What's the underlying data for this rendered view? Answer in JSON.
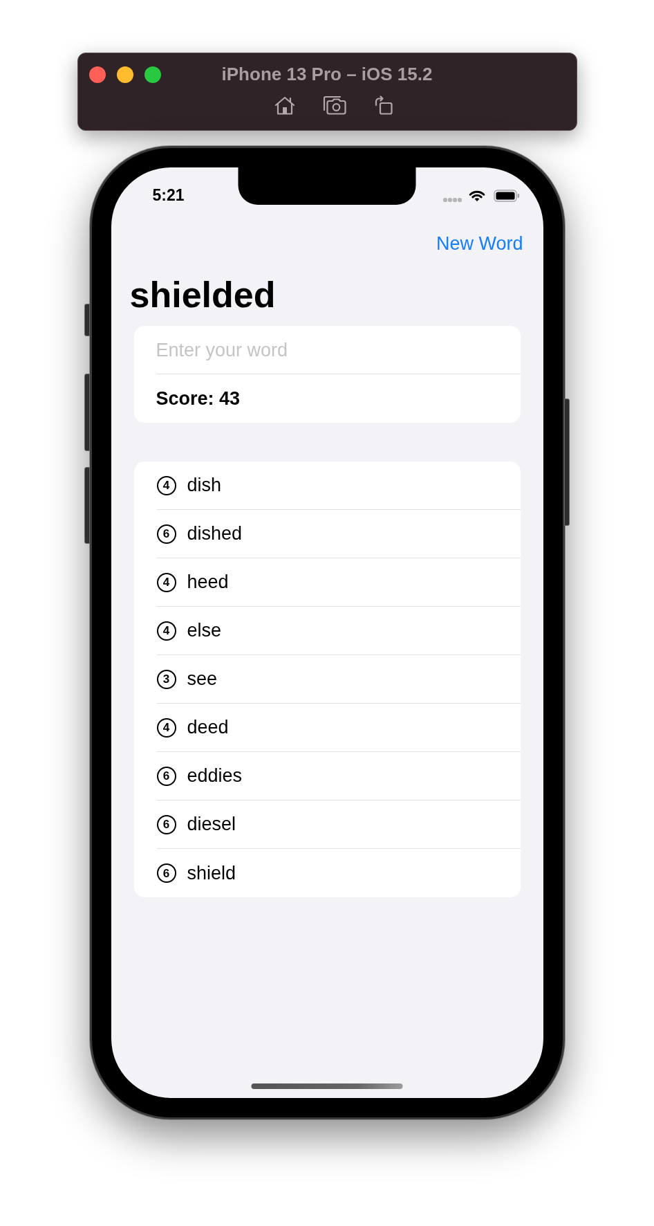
{
  "simulator_window": {
    "title": "iPhone 13 Pro – iOS 15.2"
  },
  "status_bar": {
    "time": "5:21"
  },
  "navigation": {
    "button": "New Word",
    "title": "shielded"
  },
  "form": {
    "input": {
      "placeholder": "Enter your word"
    },
    "score": "Score: 43"
  },
  "words": [
    {
      "length": "4",
      "word": "dish"
    },
    {
      "length": "6",
      "word": "dished"
    },
    {
      "length": "4",
      "word": "heed"
    },
    {
      "length": "4",
      "word": "else"
    },
    {
      "length": "3",
      "word": "see"
    },
    {
      "length": "4",
      "word": "deed"
    },
    {
      "length": "6",
      "word": "eddies"
    },
    {
      "length": "6",
      "word": "diesel"
    },
    {
      "length": "6",
      "word": "shield"
    }
  ]
}
